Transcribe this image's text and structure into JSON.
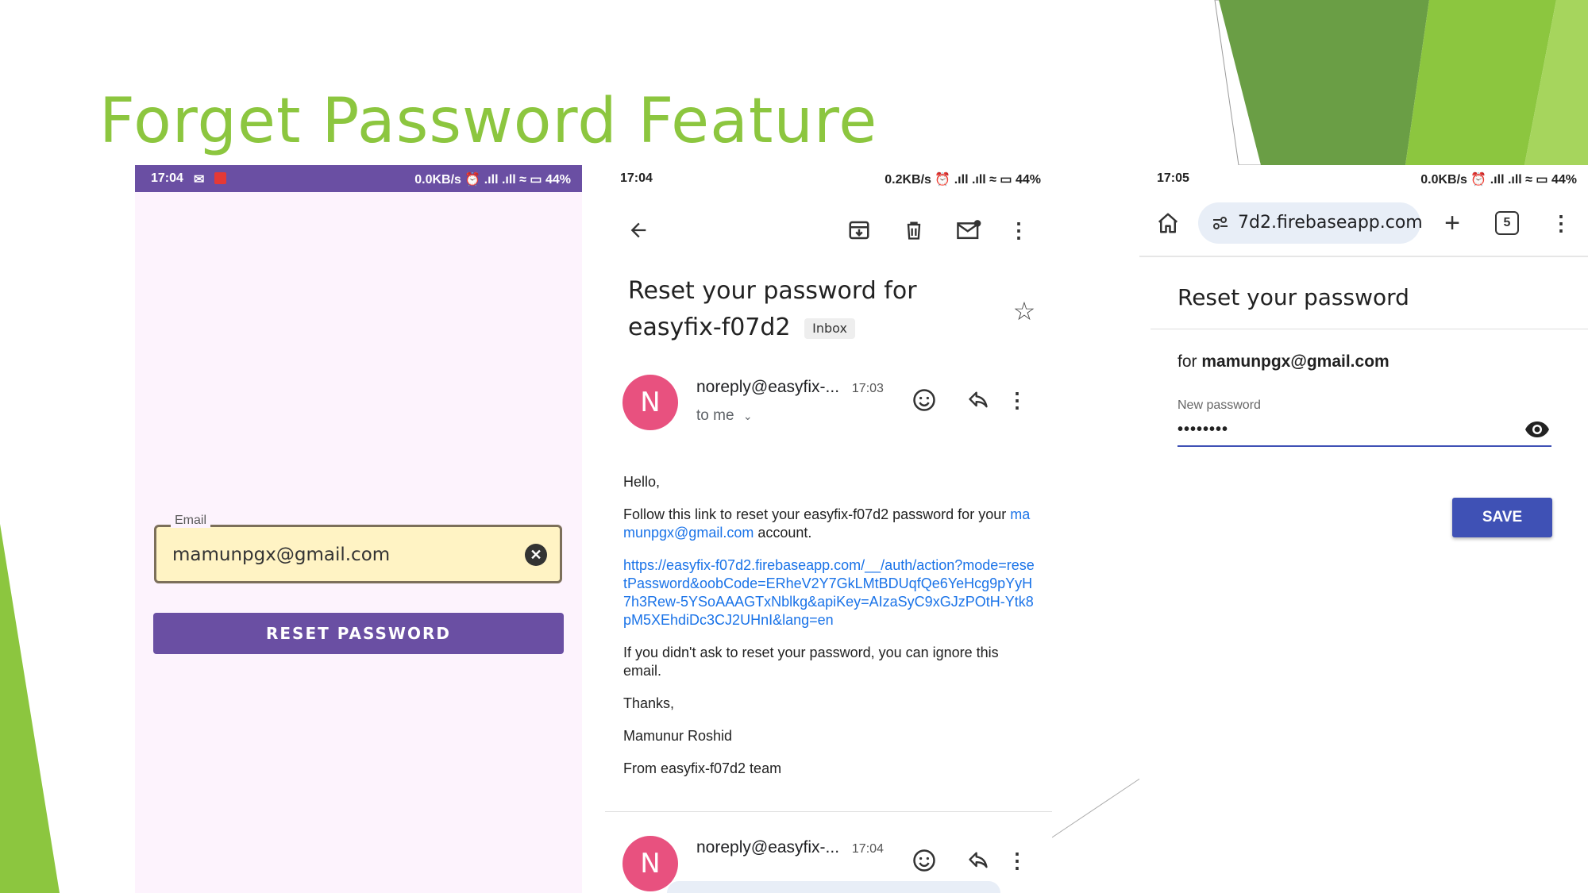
{
  "slide": {
    "title": "Forget Password Feature"
  },
  "screen1": {
    "status": {
      "time": "17:04",
      "right": "0.0KB/s ⏰ .ıll .ıll ≈ ▭ 44%"
    },
    "email_label": "Email",
    "email_value": "mamunpgx@gmail.com",
    "reset_button": "RESET PASSWORD",
    "colors": {
      "status_bar": "#6a4fa3",
      "field_bg": "#fff3c4",
      "button": "#6a4fa3",
      "background": "#fdf3fd"
    }
  },
  "screen2": {
    "status": {
      "time": "17:04",
      "right": "0.2KB/s ⏰ .ıll .ıll ≈ ▭ 44%"
    },
    "subject": "Reset your password for easyfix-f07d2",
    "inbox_badge": "Inbox",
    "message1": {
      "avatar_letter": "N",
      "sender": "noreply@easyfix-...",
      "time": "17:03",
      "to": "to me"
    },
    "body": {
      "greeting": "Hello,",
      "line1_pre": "Follow this link to reset your easyfix-f07d2 password for your ",
      "line1_email": "mamunpgx@gmail.com",
      "line1_post": " account.",
      "link": "https://easyfix-f07d2.firebaseapp.com/__/auth/action?mode=resetPassword&oobCode=ERheV2Y7GkLMtBDUqfQe6YeHcg9pYyH7h3Rew-5YSoAAAGTxNblkg&apiKey=AIzaSyC9xGJzPOtH-Ytk8pM5XEhdiDc3CJ2UHnI&lang=en",
      "ignore": "If you didn't ask to reset your password, you can ignore this email.",
      "thanks": "Thanks,",
      "name": "Mamunur Roshid",
      "team": "From easyfix-f07d2 team"
    },
    "message2": {
      "avatar_letter": "N",
      "sender": "noreply@easyfix-...",
      "time": "17:04"
    },
    "colors": {
      "avatar": "#e8517f",
      "link": "#1a73e8"
    }
  },
  "screen3": {
    "status": {
      "time": "17:05",
      "right": "0.0KB/s ⏰ .ıll .ıll ≈ ▭ 44%"
    },
    "url": "7d2.firebaseapp.com",
    "tab_count": "5",
    "heading": "Reset your password",
    "for_prefix": "for ",
    "for_email": "mamunpgx@gmail.com",
    "password_label": "New password",
    "password_value": "••••••••",
    "save_button": "SAVE",
    "colors": {
      "accent": "#3f51b5",
      "urlbar": "#e8eef7"
    }
  }
}
